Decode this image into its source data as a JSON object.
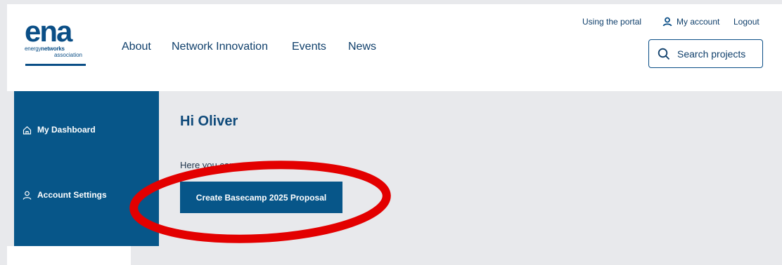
{
  "header": {
    "logo": {
      "mark": "ena",
      "line1_pre": "energy",
      "line1_bold": "networks",
      "line2": "association"
    },
    "nav": [
      "About",
      "Network Innovation",
      "Events",
      "News"
    ],
    "top_links": {
      "portal": "Using the portal",
      "account": "My account",
      "logout": "Logout"
    },
    "search_label": "Search projects"
  },
  "sidebar": {
    "items": [
      {
        "label": "My Dashboard",
        "icon": "home-icon"
      },
      {
        "label": "Account Settings",
        "icon": "user-icon"
      }
    ]
  },
  "main": {
    "greeting": "Hi Oliver",
    "subtext": "Here you can:",
    "create_button": "Create Basecamp 2025 Proposal"
  },
  "colors": {
    "brand": "#075689",
    "text_dark": "#0f3f6b",
    "background": "#e8e9ec",
    "annotation": "#e30000"
  }
}
